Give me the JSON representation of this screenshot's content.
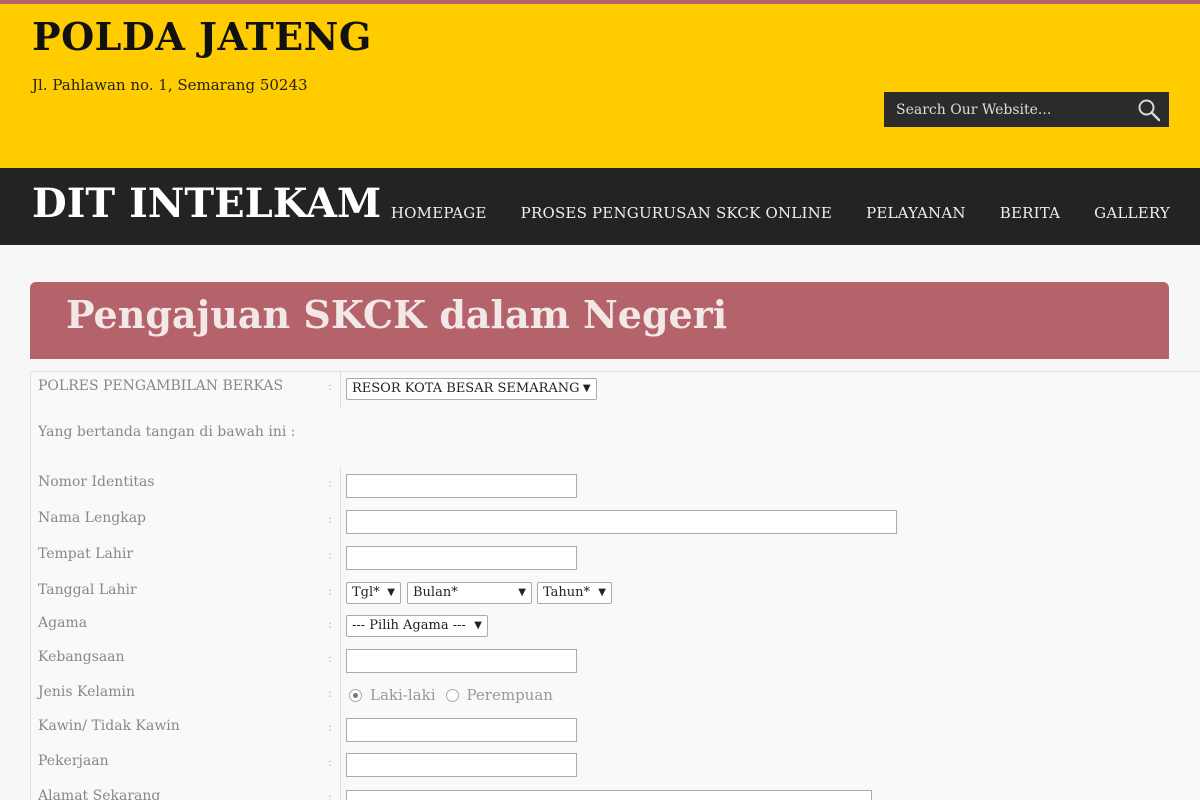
{
  "header": {
    "title": "POLDA JATENG",
    "address": "Jl. Pahlawan no. 1, Semarang 50243",
    "search_placeholder": "Search Our Website..."
  },
  "nav": {
    "brand": "DIT INTELKAM",
    "items": [
      {
        "label": "HOMEPAGE"
      },
      {
        "label": "PROSES PENGURUSAN SKCK ONLINE"
      },
      {
        "label": "PELAYANAN"
      },
      {
        "label": "BERITA"
      },
      {
        "label": "GALLERY"
      }
    ]
  },
  "form": {
    "title": "Pengajuan SKCK dalam Negeri",
    "colon": ":",
    "polres": {
      "label": "POLRES PENGAMBILAN BERKAS",
      "value": "RESOR KOTA BESAR SEMARANG"
    },
    "intro": "Yang bertanda tangan di bawah ini :",
    "fields": {
      "nomor_identitas": {
        "label": "Nomor Identitas",
        "value": ""
      },
      "nama_lengkap": {
        "label": "Nama Lengkap",
        "value": ""
      },
      "tempat_lahir": {
        "label": "Tempat Lahir",
        "value": ""
      },
      "tanggal_lahir": {
        "label": "Tanggal Lahir",
        "day": "Tgl*",
        "month": "Bulan*",
        "year": "Tahun*"
      },
      "agama": {
        "label": "Agama",
        "value": "--- Pilih Agama ---"
      },
      "kebangsaan": {
        "label": "Kebangsaan",
        "value": ""
      },
      "jenis_kelamin": {
        "label": "Jenis Kelamin",
        "options": [
          "Laki-laki",
          "Perempuan"
        ],
        "selected": "Laki-laki"
      },
      "kawin": {
        "label": "Kawin/ Tidak Kawin",
        "value": ""
      },
      "pekerjaan": {
        "label": "Pekerjaan",
        "value": ""
      },
      "alamat": {
        "label": "Alamat Sekarang",
        "value": ""
      }
    }
  },
  "colors": {
    "header_bg": "#ffcc00",
    "navbar_bg": "#232323",
    "banner_bg": "#b5636a"
  }
}
